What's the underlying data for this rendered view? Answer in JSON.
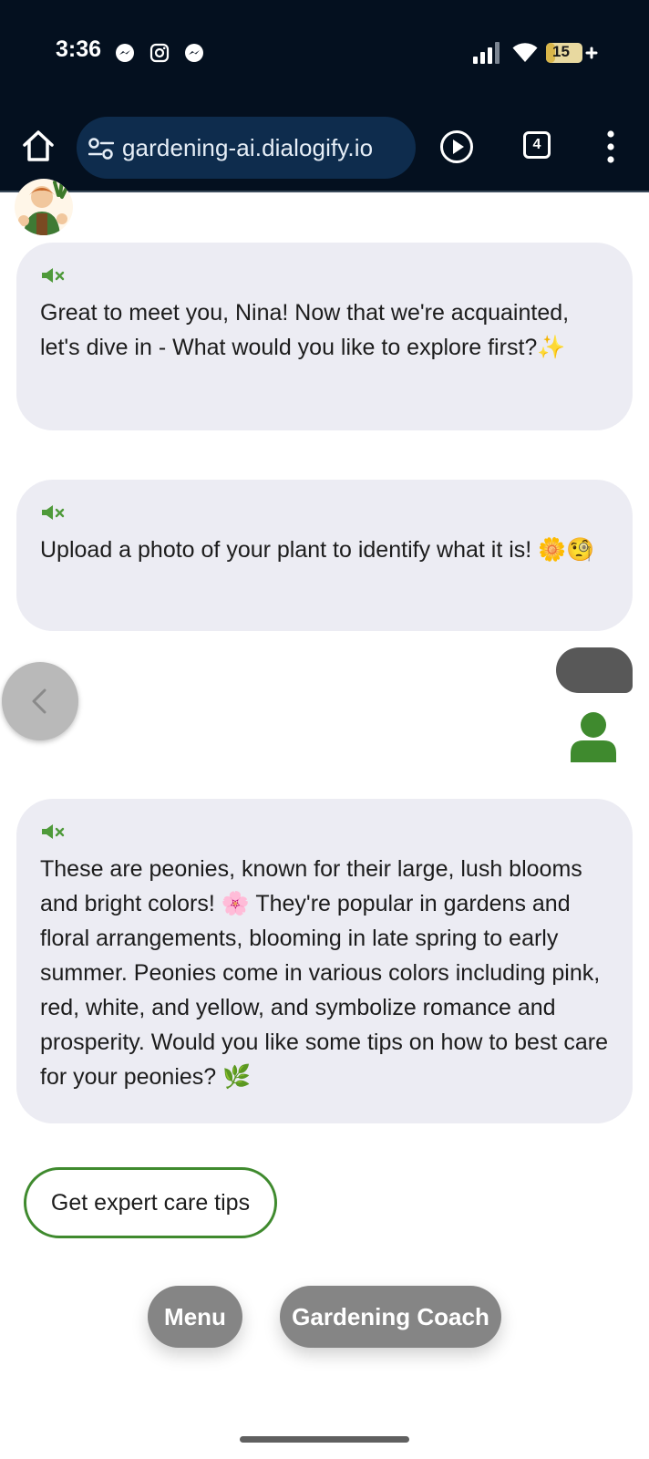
{
  "status_bar": {
    "time": "3:36",
    "notifications": [
      "messenger-icon",
      "instagram-icon",
      "messenger-icon"
    ],
    "battery": "15"
  },
  "browser": {
    "url": "gardening-ai.dialogify.io",
    "tab_count": "4"
  },
  "chat": {
    "messages": [
      {
        "role": "bot",
        "text": "Great to meet you, Nina! Now that we're acquainted, let's dive in - What would you like to explore first?✨"
      },
      {
        "role": "bot",
        "text": "Upload a photo of your plant to identify what it is! 🌼🧐"
      },
      {
        "role": "user",
        "text": ""
      },
      {
        "role": "bot",
        "text": "These are peonies, known for their large, lush blooms and bright colors! 🌸 They're popular in gardens and floral arrangements, blooming in late spring to early summer. Peonies come in various colors including pink, red, white, and yellow, and symbolize romance and prosperity. Would you like some tips on how to best care for your peonies? 🌿"
      }
    ],
    "quick_reply": "Get expert care tips"
  },
  "actions": {
    "menu": "Menu",
    "coach": "Gardening Coach"
  },
  "colors": {
    "browser_bg": "#04101f",
    "url_pill": "#0e2c4d",
    "bubble_bg": "#ececf3",
    "accent_green": "#3f8a2e",
    "user_bubble": "#585858",
    "action_button": "#858585"
  }
}
